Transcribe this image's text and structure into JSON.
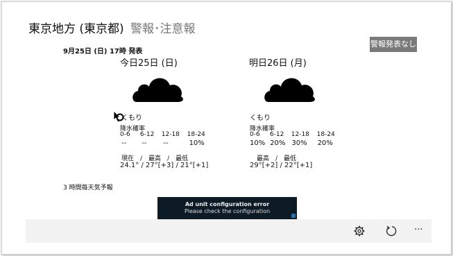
{
  "header": {
    "title": "東京地方 (東京都)",
    "subtitle": "警報･注意報",
    "warning_button": "警報発表なし"
  },
  "issued": "9月25日 (日) 17時 発表",
  "today": {
    "heading": "今日25日 (日)",
    "weather_icon": "cloud-icon",
    "weather": "くもり",
    "precip_label": "降水確率",
    "periods": [
      "0-6",
      "6-12",
      "12-18",
      "18-24"
    ],
    "precip": [
      "--",
      "--",
      "--",
      "10%"
    ],
    "temp_header": "現在　/　最高　/　最低",
    "temps": "24.1° / 27°[+3] / 21°[+1]"
  },
  "tomorrow": {
    "heading": "明日26日 (月)",
    "weather_icon": "cloud-icon",
    "weather": "くもり",
    "precip_label": "降水確率",
    "periods": [
      "0-6",
      "6-12",
      "12-18",
      "18-24"
    ],
    "precip": [
      "10%",
      "20%",
      "30%",
      "20%"
    ],
    "temp_header": "最高　/　最低",
    "temps": "29°[+2] / 22°[+1]"
  },
  "forecast_link": "3 時間毎天気予報",
  "ad": {
    "title": "Ad unit configuration error",
    "message": "Please check the configuration"
  },
  "appbar": {
    "icons": [
      "gear-icon",
      "refresh-icon",
      "more-icon"
    ],
    "more": "···"
  },
  "colors": {
    "warning_button_bg": "#7a7a7a",
    "ad_bg": "#0c1b26",
    "appbar_bg": "#f2f2f2"
  }
}
